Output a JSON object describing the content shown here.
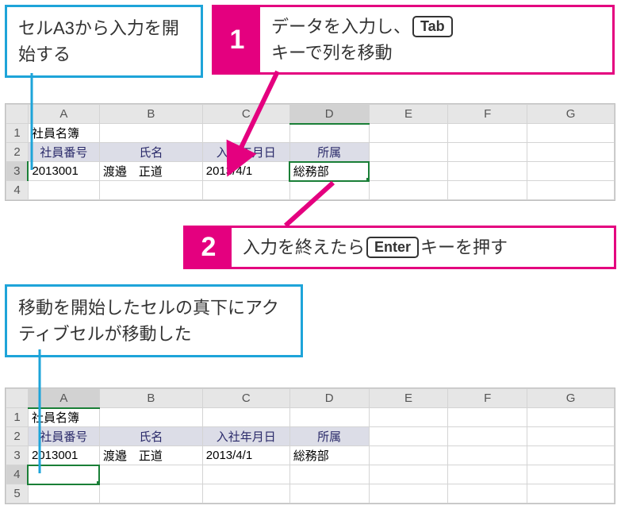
{
  "callout1": "セルA3から入力を開始する",
  "step1": {
    "num": "1",
    "text_a": "データを入力し、",
    "key": "Tab",
    "text_b": "キーで列を移動"
  },
  "step2": {
    "num": "2",
    "text_a": "入力を終えたら",
    "key": "Enter",
    "text_b": "キーを押す"
  },
  "callout2": "移動を開始したセルの真下にアクティブセルが移動した",
  "sheet1": {
    "cols": [
      "A",
      "B",
      "C",
      "D",
      "E",
      "F",
      "G"
    ],
    "rows": [
      "1",
      "2",
      "3",
      "4"
    ],
    "title": "社員名簿",
    "headers": [
      "社員番号",
      "氏名",
      "入社年月日",
      "所属"
    ],
    "data": {
      "emp_no": "2013001",
      "name": "渡邉　正道",
      "date": "2013/4/1",
      "dept": "総務部"
    }
  },
  "sheet2": {
    "cols": [
      "A",
      "B",
      "C",
      "D",
      "E",
      "F",
      "G"
    ],
    "rows": [
      "1",
      "2",
      "3",
      "4",
      "5"
    ],
    "title": "社員名簿",
    "headers": [
      "社員番号",
      "氏名",
      "入社年月日",
      "所属"
    ],
    "data": {
      "emp_no": "2013001",
      "name": "渡邉　正道",
      "date": "2013/4/1",
      "dept": "総務部"
    }
  }
}
